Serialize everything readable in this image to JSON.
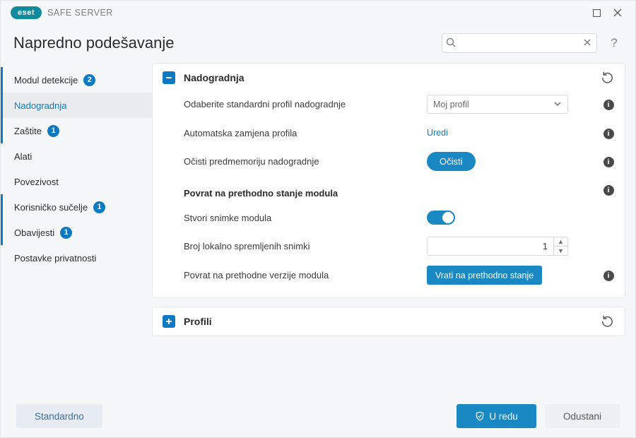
{
  "titlebar": {
    "brand": "eset",
    "product": "SAFE SERVER"
  },
  "header": {
    "title": "Napredno podešavanje",
    "search_placeholder": ""
  },
  "sidebar": {
    "items": [
      {
        "label": "Modul detekcije",
        "badge": "2",
        "marked": true
      },
      {
        "label": "Nadogradnja",
        "active": true
      },
      {
        "label": "Zaštite",
        "badge": "1",
        "marked": true
      },
      {
        "label": "Alati"
      },
      {
        "label": "Povezivost"
      },
      {
        "label": "Korisničko sučelje",
        "badge": "1",
        "marked": true
      },
      {
        "label": "Obavijesti",
        "badge": "1",
        "marked": true
      },
      {
        "label": "Postavke privatnosti"
      }
    ]
  },
  "panel_update": {
    "title": "Nadogradnja",
    "rows": {
      "default_profile": {
        "label": "Odaberite standardni profil nadogradnje",
        "value": "Moj profil"
      },
      "auto_switch": {
        "label": "Automatska zamjena profila",
        "action": "Uredi"
      },
      "clear_cache": {
        "label": "Očisti predmemoriju nadogradnje",
        "action": "Očisti"
      }
    },
    "rollback": {
      "heading": "Povrat na prethodno stanje modula",
      "create_snapshots": {
        "label": "Stvori snimke modula"
      },
      "snapshot_count": {
        "label": "Broj lokalno spremljenih snimki",
        "value": "1"
      },
      "rollback_action": {
        "label": "Povrat na prethodne verzije modula",
        "action": "Vrati na prethodno stanje"
      }
    }
  },
  "panel_profiles": {
    "title": "Profili"
  },
  "footer": {
    "default": "Standardno",
    "ok": "U redu",
    "cancel": "Odustani"
  }
}
